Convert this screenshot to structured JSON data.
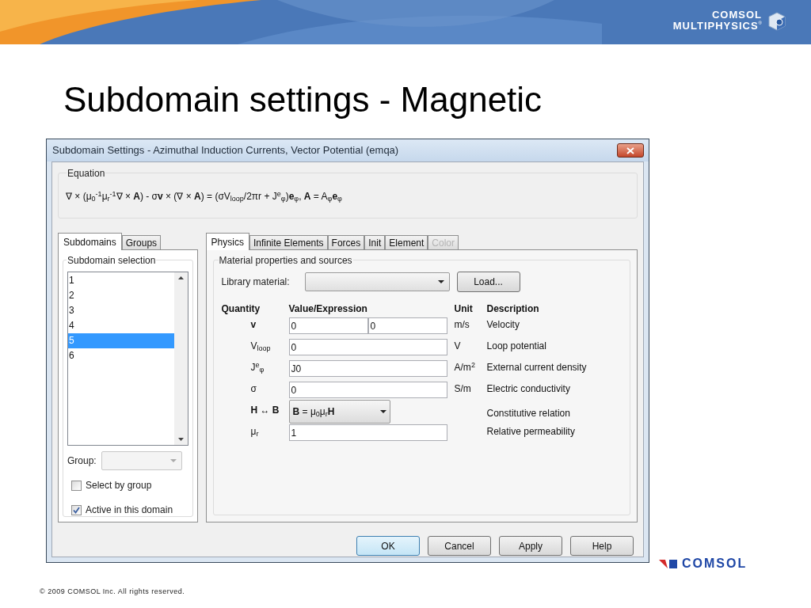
{
  "header": {
    "logo_line1": "COMSOL",
    "logo_line2": "MULTIPHYSICS",
    "logo_mark": "®"
  },
  "slide_title": "Subdomain settings - Magnetic",
  "window": {
    "title": "Subdomain Settings - Azimuthal Induction Currents, Vector Potential (emqa)",
    "equation": {
      "label": "Equation",
      "text": "∇ × (μ$_{0}$$^{-1}$μ$_{r}$$^{-1}$∇ × **A**) - σ**v** × (∇ × **A**) = (σV$_{loop}$/2πr + J$^{e}$$_{φ}$)**e**$_{φ}$, **A** = A$_{φ}$**e**$_{φ}$"
    },
    "left_tabs": [
      {
        "label": "Subdomains",
        "selected": true
      },
      {
        "label": "Groups",
        "selected": false
      }
    ],
    "subdomain_selection": {
      "label": "Subdomain selection",
      "items": [
        {
          "label": "1",
          "selected": false
        },
        {
          "label": "2",
          "selected": false
        },
        {
          "label": "3",
          "selected": false
        },
        {
          "label": "4",
          "selected": false
        },
        {
          "label": "5",
          "selected": true
        },
        {
          "label": "6",
          "selected": false
        }
      ],
      "group_label": "Group:",
      "checkboxes": [
        {
          "label": "Select by group",
          "checked": false
        },
        {
          "label": "Active in this domain",
          "checked": true
        }
      ]
    },
    "right_tabs": [
      {
        "label": "Physics",
        "selected": true,
        "disabled": false
      },
      {
        "label": "Infinite Elements",
        "selected": false,
        "disabled": false
      },
      {
        "label": "Forces",
        "selected": false,
        "disabled": false
      },
      {
        "label": "Init",
        "selected": false,
        "disabled": false
      },
      {
        "label": "Element",
        "selected": false,
        "disabled": false
      },
      {
        "label": "Color",
        "selected": false,
        "disabled": true
      }
    ],
    "material": {
      "label": "Material properties and sources",
      "library_label": "Library material:",
      "load_button": "Load..."
    },
    "columns": [
      "Quantity",
      "Value/Expression",
      "Unit",
      "Description"
    ],
    "rows": [
      {
        "kind": "pair",
        "quantity": "v",
        "bold": true,
        "values": [
          "0",
          "0"
        ],
        "unit": "m/s",
        "description": "Velocity"
      },
      {
        "kind": "field",
        "quantity": "V$_{loop}$",
        "bold": false,
        "values": [
          "0"
        ],
        "unit": "V",
        "description": "Loop potential"
      },
      {
        "kind": "field",
        "quantity": "J$^{e}$$_{φ}$",
        "bold": false,
        "values": [
          "J0"
        ],
        "unit": "A/m$^{2}$",
        "description": "External current density"
      },
      {
        "kind": "field",
        "quantity": "σ",
        "bold": false,
        "values": [
          "0"
        ],
        "unit": "S/m",
        "description": "Electric conductivity"
      },
      {
        "kind": "select",
        "quantity": "H ↔ B",
        "bold": true,
        "values": [
          "**B** = μ$_{0}$μ$_{r}$**H**"
        ],
        "description": "Constitutive relation"
      },
      {
        "kind": "field",
        "quantity": "μ$_{r}$",
        "bold": false,
        "values": [
          "1"
        ],
        "description": "Relative permeability"
      }
    ],
    "buttons": [
      {
        "label": "OK",
        "default": true
      },
      {
        "label": "Cancel",
        "default": false
      },
      {
        "label": "Apply",
        "default": false
      },
      {
        "label": "Help",
        "default": false
      }
    ]
  },
  "footer": {
    "copyright": "© 2009 COMSOL Inc. All rights reserved.",
    "logo": "COMSOL"
  }
}
